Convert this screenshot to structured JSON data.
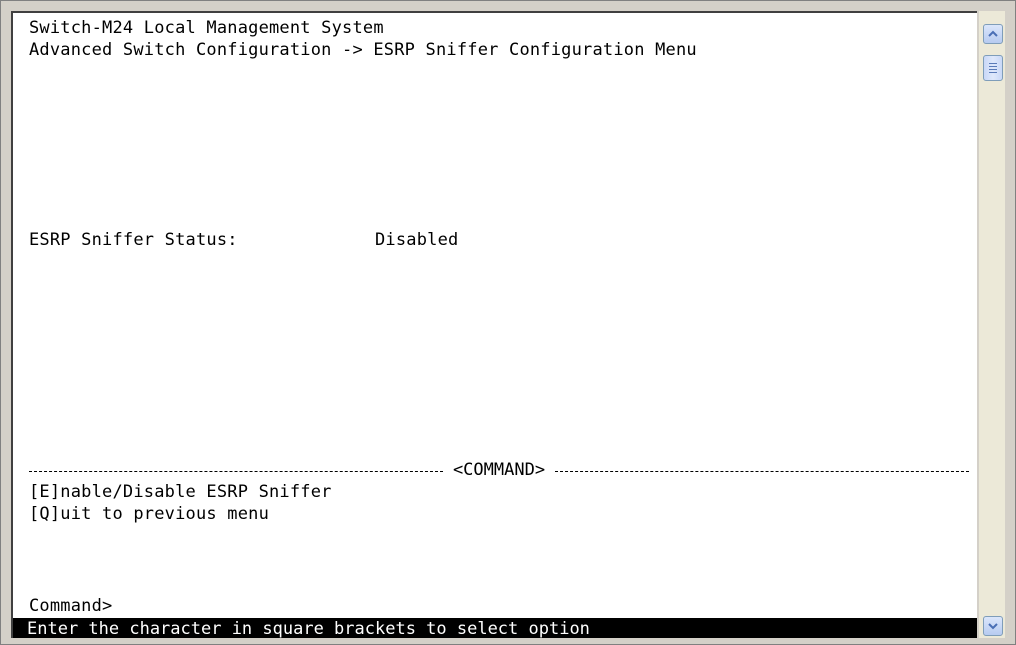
{
  "terminal": {
    "title_line": "Switch-M24 Local Management System",
    "breadcrumb_line": "Advanced Switch Configuration -> ESRP Sniffer Configuration Menu",
    "status_label": "ESRP Sniffer Status:",
    "status_value": "Disabled",
    "command_rule_label": "<COMMAND>",
    "option_enable": "[E]nable/Disable ESRP Sniffer",
    "option_quit": "[Q]uit to previous menu",
    "prompt": "Command>",
    "status_bar": "Enter the character in square brackets to select option"
  },
  "scrollbar": {
    "up_icon": "scroll-up-arrow",
    "down_icon": "scroll-down-arrow",
    "thumb_icon": "scroll-thumb-grip"
  },
  "colors": {
    "background": "#ffffff",
    "text": "#000000",
    "status_bar_bg": "#000000",
    "status_bar_text": "#ffffff",
    "scroll_accent": "#4a6fb5"
  }
}
